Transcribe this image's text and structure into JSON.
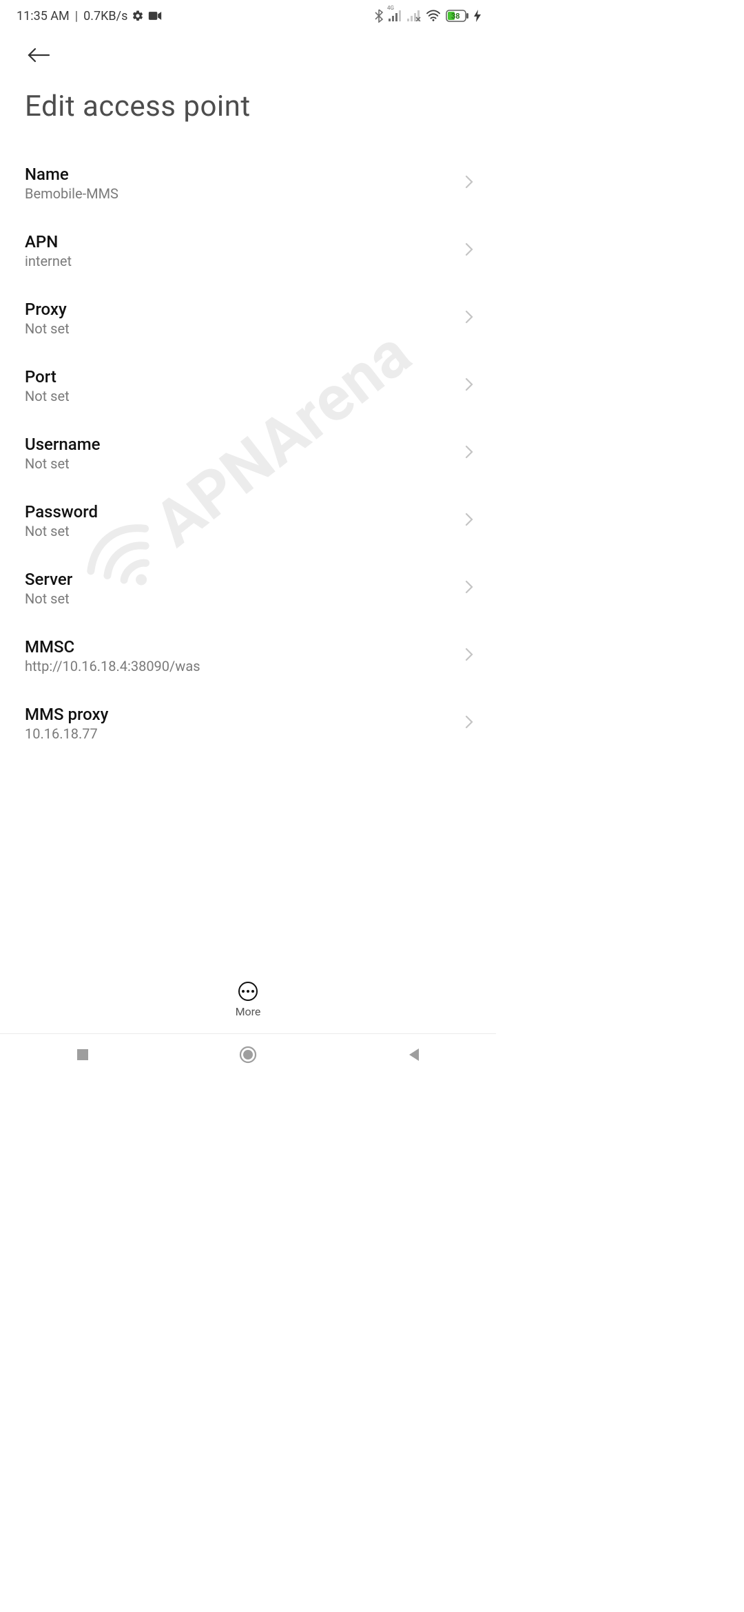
{
  "status": {
    "time": "11:35 AM",
    "net_rate": "0.7KB/s",
    "signal_tag": "4G",
    "battery_pct": "38"
  },
  "header": {
    "title": "Edit access point"
  },
  "rows": [
    {
      "title": "Name",
      "value": "Bemobile-MMS"
    },
    {
      "title": "APN",
      "value": "internet"
    },
    {
      "title": "Proxy",
      "value": "Not set"
    },
    {
      "title": "Port",
      "value": "Not set"
    },
    {
      "title": "Username",
      "value": "Not set"
    },
    {
      "title": "Password",
      "value": "Not set"
    },
    {
      "title": "Server",
      "value": "Not set"
    },
    {
      "title": "MMSC",
      "value": "http://10.16.18.4:38090/was"
    },
    {
      "title": "MMS proxy",
      "value": "10.16.18.77"
    }
  ],
  "bottom": {
    "more_label": "More"
  },
  "watermark": {
    "text": "APNArena"
  },
  "icons": {
    "back": "arrow-left-icon",
    "chevron": "chevron-right-icon",
    "gear": "gear-icon",
    "camera": "camera-icon",
    "bluetooth": "bluetooth-icon",
    "signal1": "signal-4g-icon",
    "signal2": "signal-no-sim-icon",
    "wifi": "wifi-icon",
    "battery": "battery-icon",
    "bolt": "charging-bolt-icon",
    "nav_recent": "nav-recent-icon",
    "nav_home": "nav-home-icon",
    "nav_back": "nav-back-icon",
    "wifi_wm": "wifi-watermark-icon"
  }
}
